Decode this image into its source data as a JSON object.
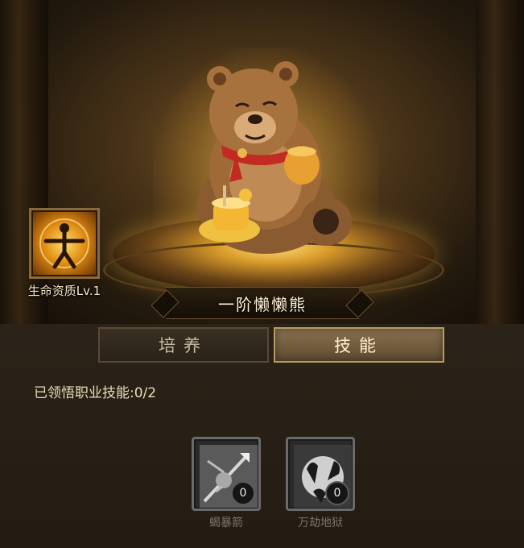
{
  "pet": {
    "name": "一阶懒懒熊"
  },
  "talent": {
    "label": "生命资质Lv.1",
    "icon": "vitruvian-figure-icon"
  },
  "tabs": [
    {
      "label": "培养",
      "active": false
    },
    {
      "label": "技能",
      "active": true
    }
  ],
  "skills_panel": {
    "learned_text": "已领悟职业技能:0/2",
    "skills": [
      {
        "name": "蝎暴箭",
        "count": "0",
        "icon": "arrow-burst-icon"
      },
      {
        "name": "万劫地狱",
        "count": "0",
        "icon": "hellfire-hands-icon"
      }
    ]
  },
  "colors": {
    "accent_gold": "#d89a2a",
    "active_tab": "#8a7250",
    "panel_bg": "#241c13"
  }
}
